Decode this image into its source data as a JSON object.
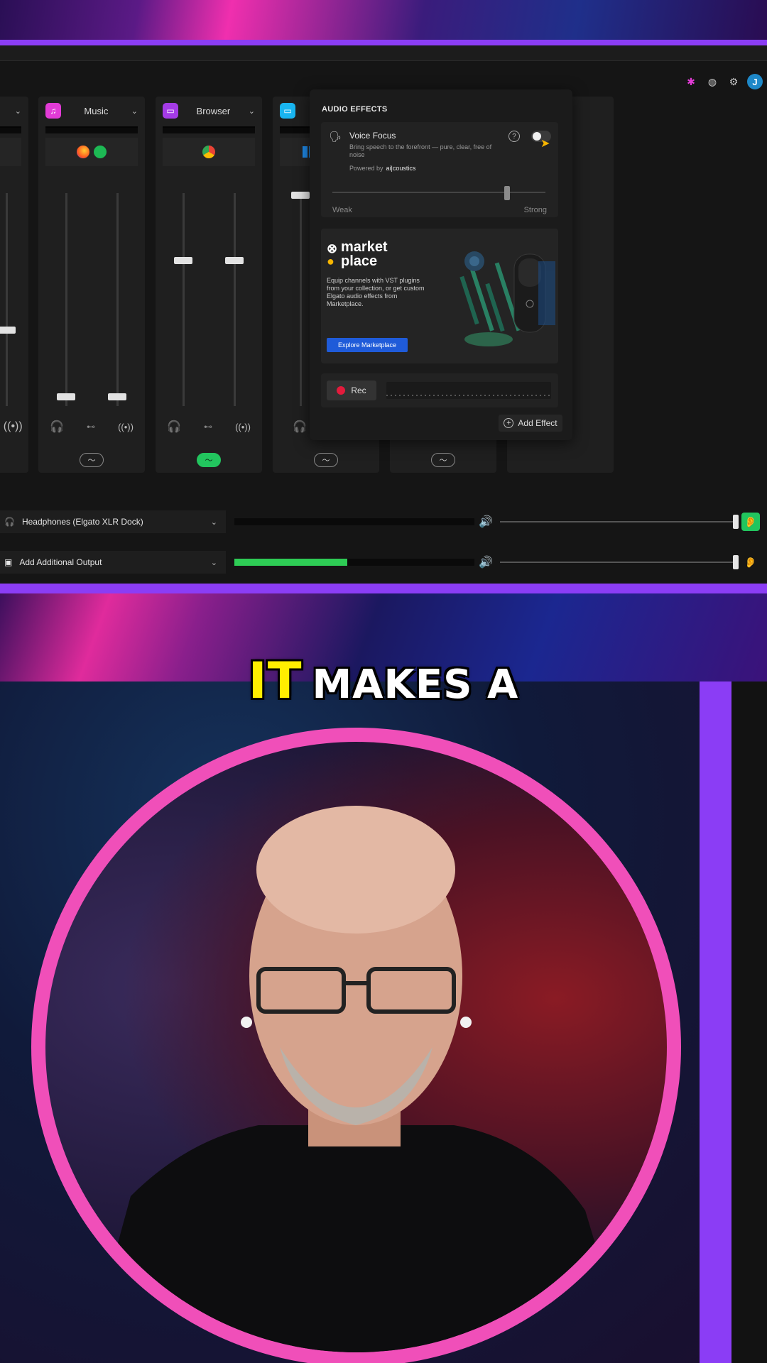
{
  "channels": [
    {
      "name": "Music",
      "icon": "music-note-icon",
      "color": "#e23bd6"
    },
    {
      "name": "Browser",
      "icon": "browser-window-icon",
      "color": "#a43be6"
    },
    {
      "name": "",
      "icon": "monitor-icon",
      "color": "#19b5f0"
    }
  ],
  "audio_effects": {
    "title": "AUDIO EFFECTS",
    "voice_focus": {
      "name": "Voice Focus",
      "description": "Bring speech to the forefront — pure, clear, free of noise",
      "powered_by": "Powered by",
      "brand": "ai|coustics",
      "strength_min_label": "Weak",
      "strength_max_label": "Strong",
      "strength": 0.82,
      "enabled": false
    },
    "marketplace": {
      "logo_line1": "market",
      "logo_line2": "place",
      "description": "Equip channels with VST plugins from your collection, or get custom Elgato audio effects from Marketplace.",
      "button_label": "Explore Marketplace"
    },
    "rec_label": "Rec",
    "add_effect_label": "Add Effect"
  },
  "outputs": [
    {
      "name": "Headphones (Elgato XLR Dock)",
      "level": 0.0,
      "volume": 1.0,
      "monitor": true
    },
    {
      "name": "Add Additional Output",
      "level": 0.47,
      "volume": 1.0,
      "monitor": false
    }
  ],
  "toolbar": {
    "avatar_letter": "J"
  },
  "caption": {
    "highlight": "IT",
    "rest": "MAKES A"
  },
  "colors": {
    "accent_purple": "#8b3df5",
    "accent_pink": "#f04fb9",
    "green": "#22c55e",
    "caption_yellow": "#ffee00"
  }
}
